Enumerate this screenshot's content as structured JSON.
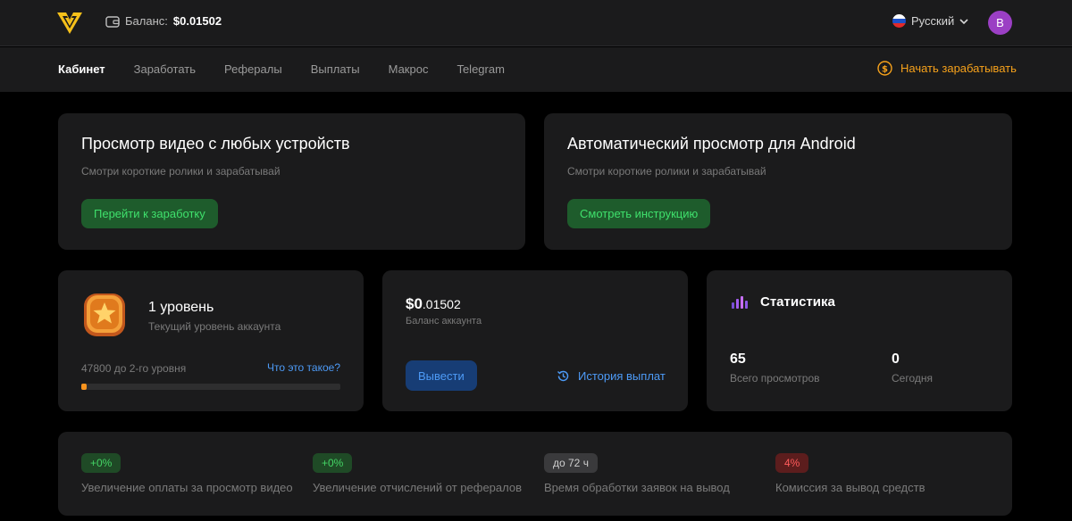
{
  "header": {
    "balance_label": "Баланс:",
    "balance_value": "$0.01502",
    "language": "Русский",
    "avatar_letter": "B"
  },
  "nav": {
    "items": [
      "Кабинет",
      "Заработать",
      "Рефералы",
      "Выплаты",
      "Макрос",
      "Telegram"
    ],
    "active": "Кабинет",
    "start_earning": "Начать зарабатывать"
  },
  "promo": [
    {
      "title": "Просмотр видео с любых устройств",
      "subtitle": "Смотри короткие ролики и зарабатывай",
      "button": "Перейти к заработку"
    },
    {
      "title": "Автоматический просмотр для Android",
      "subtitle": "Смотри короткие ролики и зарабатывай",
      "button": "Смотреть инструкцию"
    }
  ],
  "level": {
    "title": "1 уровень",
    "subtitle": "Текущий уровень аккаунта",
    "progress_text": "47800 до 2-го уровня",
    "help_link": "Что это такое?",
    "progress_fraction": 0.02
  },
  "account_balance": {
    "main": "$0",
    "decimals": ".01502",
    "label": "Баланс аккаунта",
    "withdraw": "Вывести",
    "history": "История выплат"
  },
  "stats": {
    "title": "Статистика",
    "total_views_value": "65",
    "total_views_label": "Всего просмотров",
    "today_value": "0",
    "today_label": "Сегодня"
  },
  "features": [
    {
      "badge": "+0%",
      "color": "green",
      "text": "Увеличение оплаты за просмотр видео"
    },
    {
      "badge": "+0%",
      "color": "green",
      "text": "Увеличение отчислений от рефералов"
    },
    {
      "badge": "до 72 ч",
      "color": "gray",
      "text": "Время обработки заявок на вывод"
    },
    {
      "badge": "4%",
      "color": "red",
      "text": "Комиссия за вывод средств"
    }
  ],
  "colors": {
    "accent_orange": "#f7a21b",
    "green": "#3fe06c",
    "blue": "#4d9bf7",
    "avatar": "#9b3fc4"
  },
  "icons": [
    "logo-icon",
    "wallet-icon",
    "russia-flag-icon",
    "chevron-down-icon",
    "dollar-coin-icon",
    "star-badge-icon",
    "history-icon",
    "stats-bars-icon"
  ]
}
